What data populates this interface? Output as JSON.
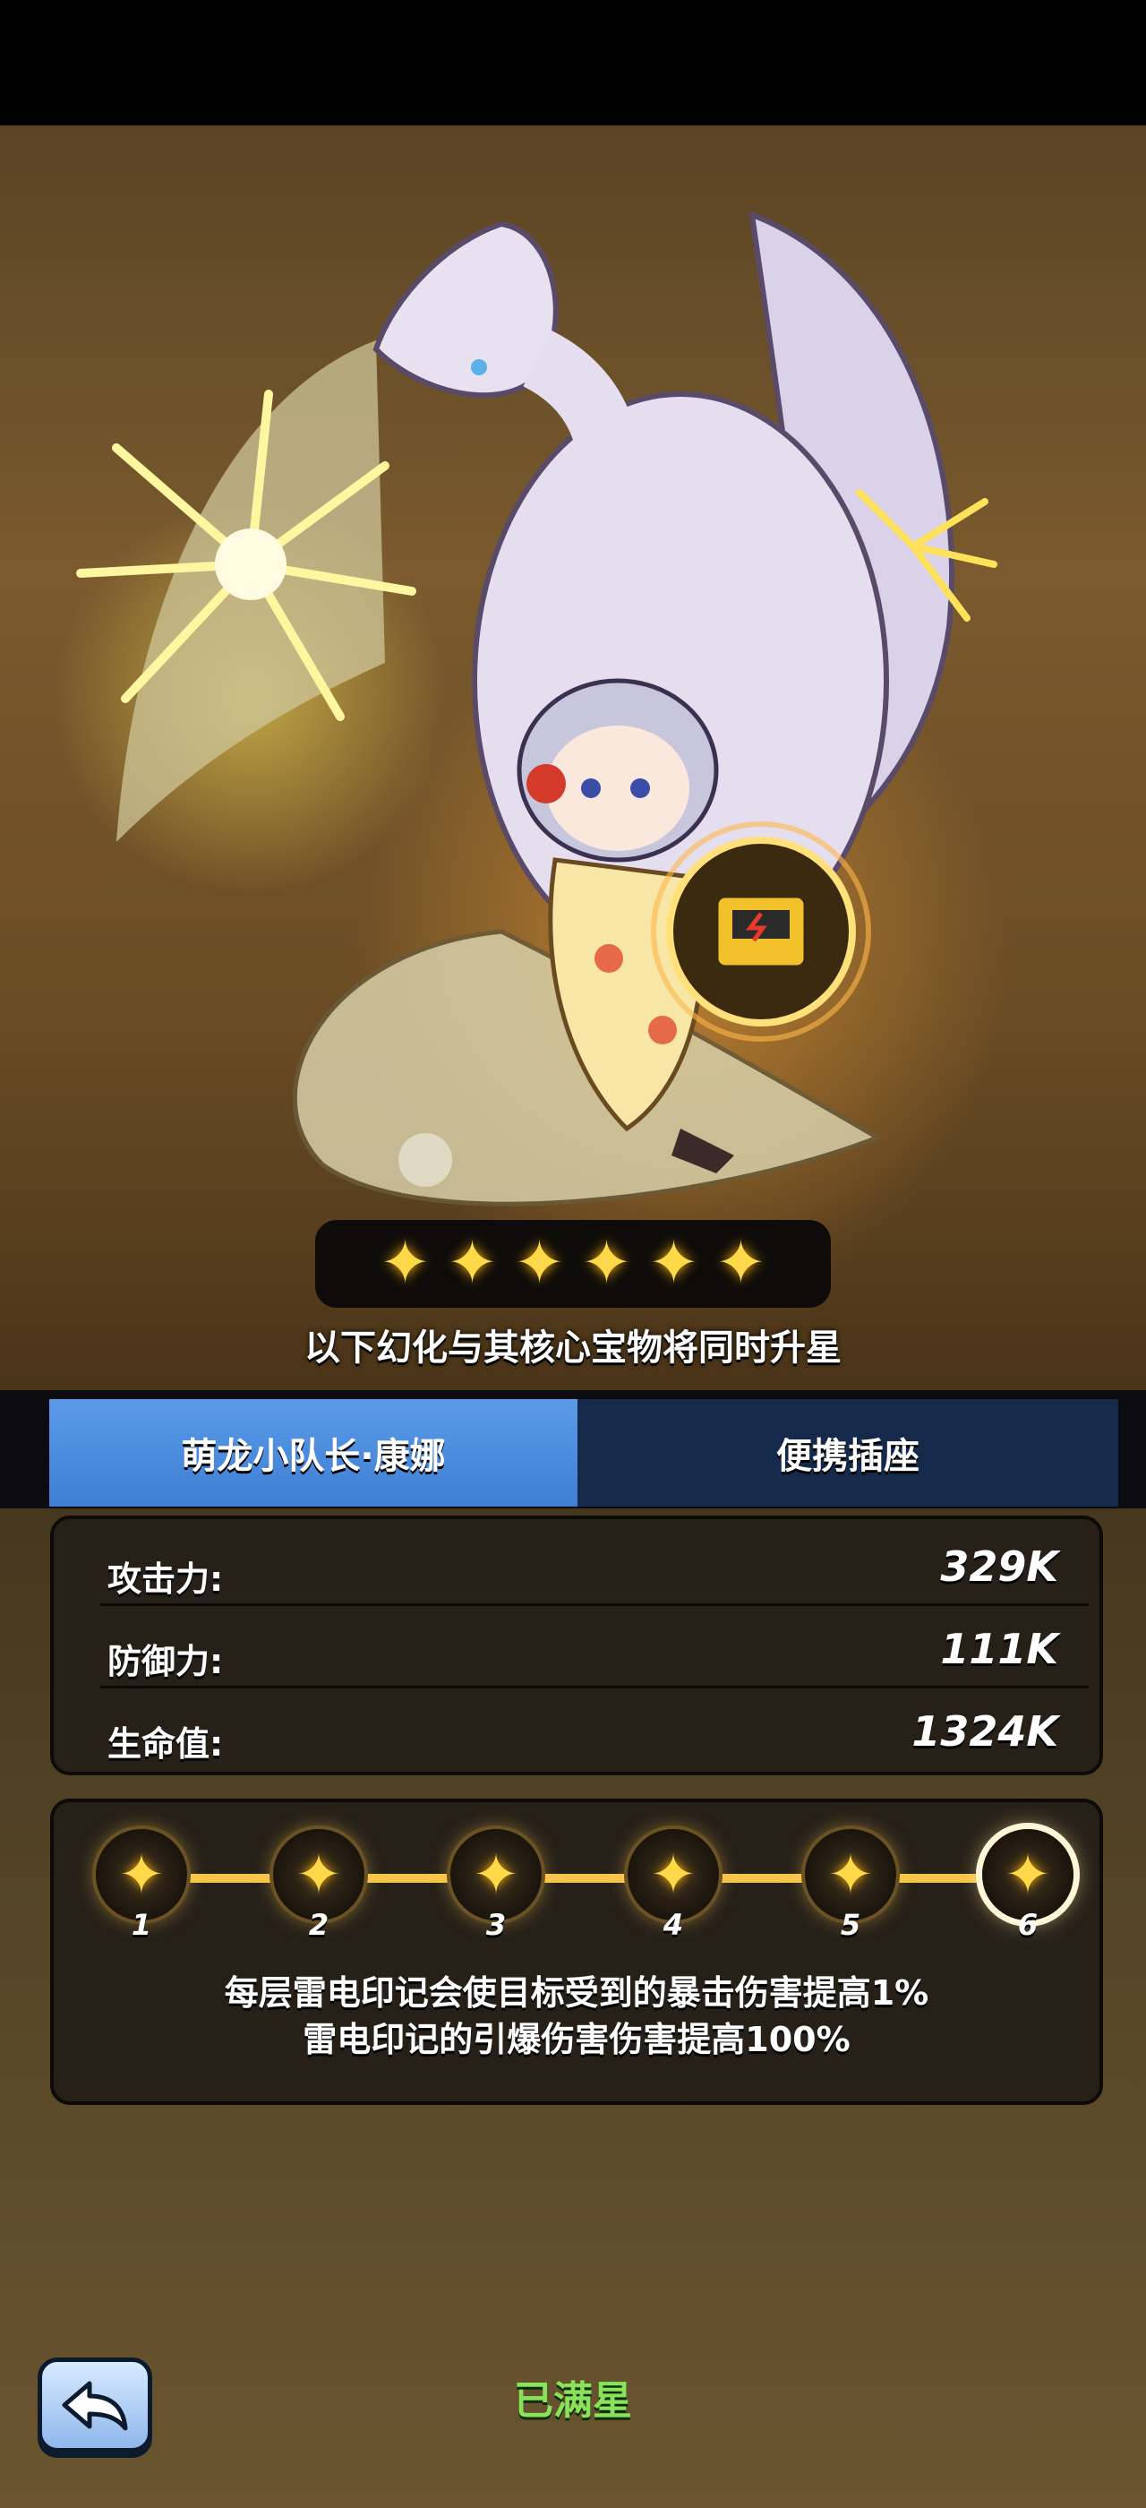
{
  "hero": {
    "star_count": 6,
    "sync_note": "以下幻化与其核心宝物将同时升星"
  },
  "tabs": [
    {
      "label": "萌龙小队长·康娜",
      "active": true
    },
    {
      "label": "便携插座",
      "active": false
    }
  ],
  "stats": [
    {
      "label": "攻击力:",
      "value": "329K"
    },
    {
      "label": "防御力:",
      "value": "111K"
    },
    {
      "label": "生命值:",
      "value": "1324K"
    }
  ],
  "upgrade": {
    "levels": [
      "1",
      "2",
      "3",
      "4",
      "5",
      "6"
    ],
    "current_level": 6,
    "effect_lines": [
      "每层雷电印记会使目标受到的暴击伤害提高1%",
      "雷电印记的引爆伤害伤害提高100%"
    ]
  },
  "footer": {
    "status": "已满星",
    "back_icon": "back-arrow-icon"
  },
  "colors": {
    "accent_gold": "#ffd94a",
    "tab_active": "#4a8be0",
    "tab_inactive": "#15294a",
    "maxed_green": "#88e35a"
  }
}
